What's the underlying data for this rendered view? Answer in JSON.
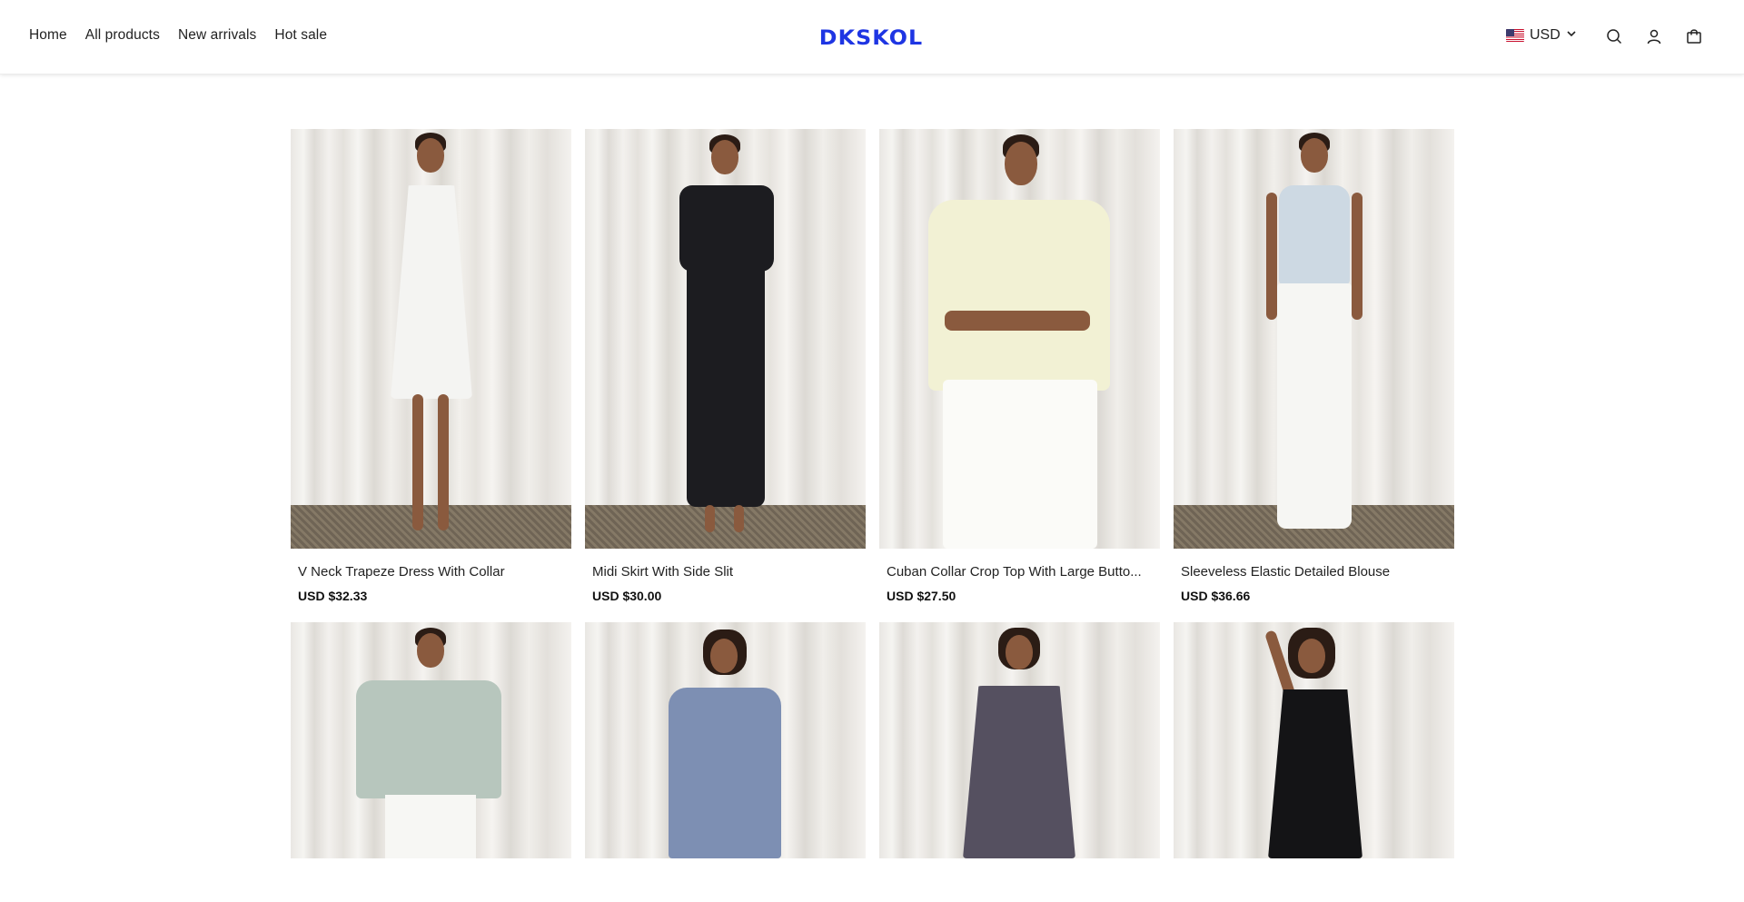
{
  "header": {
    "nav": [
      "Home",
      "All products",
      "New arrivals",
      "Hot sale"
    ],
    "logo": "DKSKOL",
    "currency": {
      "code": "USD",
      "flag_icon": "us-flag-icon"
    },
    "icons": [
      "search-icon",
      "account-icon",
      "cart-icon"
    ],
    "brand_color": "#1e35e3"
  },
  "products": [
    {
      "title": "V Neck Trapeze Dress With Collar",
      "price": "USD $32.33",
      "garment_color": "#f4f4f2"
    },
    {
      "title": "Midi Skirt With Side Slit",
      "price": "USD $30.00",
      "garment_color": "#1c1c20"
    },
    {
      "title": "Cuban Collar Crop Top With Large Butto...",
      "price": "USD $27.50",
      "garment_color": "#f2f1d4"
    },
    {
      "title": "Sleeveless Elastic Detailed Blouse",
      "price": "USD $36.66",
      "garment_color": "#cdd9e3"
    },
    {
      "title": "",
      "price": "",
      "garment_color": "#b7c6bd"
    },
    {
      "title": "",
      "price": "",
      "garment_color": "#7d8fb3"
    },
    {
      "title": "",
      "price": "",
      "garment_color": "#555060"
    },
    {
      "title": "",
      "price": "",
      "garment_color": "#141416"
    }
  ]
}
